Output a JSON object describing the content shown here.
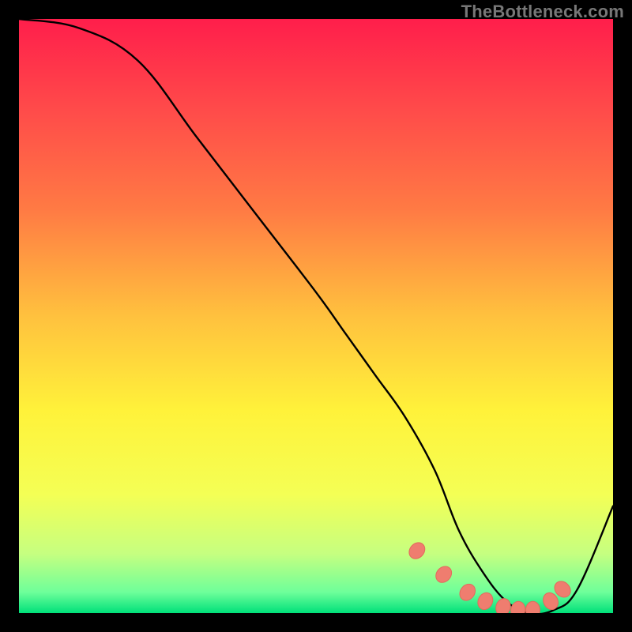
{
  "watermark": "TheBottleneck.com",
  "chart_data": {
    "type": "line",
    "title": "",
    "xlabel": "",
    "ylabel": "",
    "xlim": [
      0,
      100
    ],
    "ylim": [
      0,
      100
    ],
    "grid": false,
    "series": [
      {
        "name": "curve",
        "x": [
          0,
          10,
          20,
          30,
          40,
          50,
          55,
          60,
          65,
          70,
          74,
          78,
          82,
          86,
          90,
          94,
          100
        ],
        "y": [
          100,
          98.5,
          93,
          80,
          67,
          54,
          47,
          40,
          33,
          24,
          14,
          7,
          2,
          0,
          0.5,
          4,
          18
        ]
      }
    ],
    "markers": {
      "name": "dots",
      "x": [
        67,
        71.5,
        75.5,
        78.5,
        81.5,
        84,
        86.5,
        89.5,
        91.5
      ],
      "y": [
        10.5,
        6.5,
        3.5,
        2,
        1,
        0.5,
        0.5,
        2,
        4
      ]
    },
    "colors": {
      "curve": "#000000",
      "marker_fill": "#ef7d6f",
      "marker_stroke": "#e36a5c",
      "gradient_stops": [
        {
          "offset": 0.0,
          "color": "#ff1e4b"
        },
        {
          "offset": 0.15,
          "color": "#ff4a4a"
        },
        {
          "offset": 0.32,
          "color": "#ff7a44"
        },
        {
          "offset": 0.5,
          "color": "#ffc13e"
        },
        {
          "offset": 0.66,
          "color": "#fff23a"
        },
        {
          "offset": 0.8,
          "color": "#f4ff55"
        },
        {
          "offset": 0.9,
          "color": "#c6ff80"
        },
        {
          "offset": 0.965,
          "color": "#6eff9a"
        },
        {
          "offset": 1.0,
          "color": "#00e07a"
        }
      ]
    }
  }
}
